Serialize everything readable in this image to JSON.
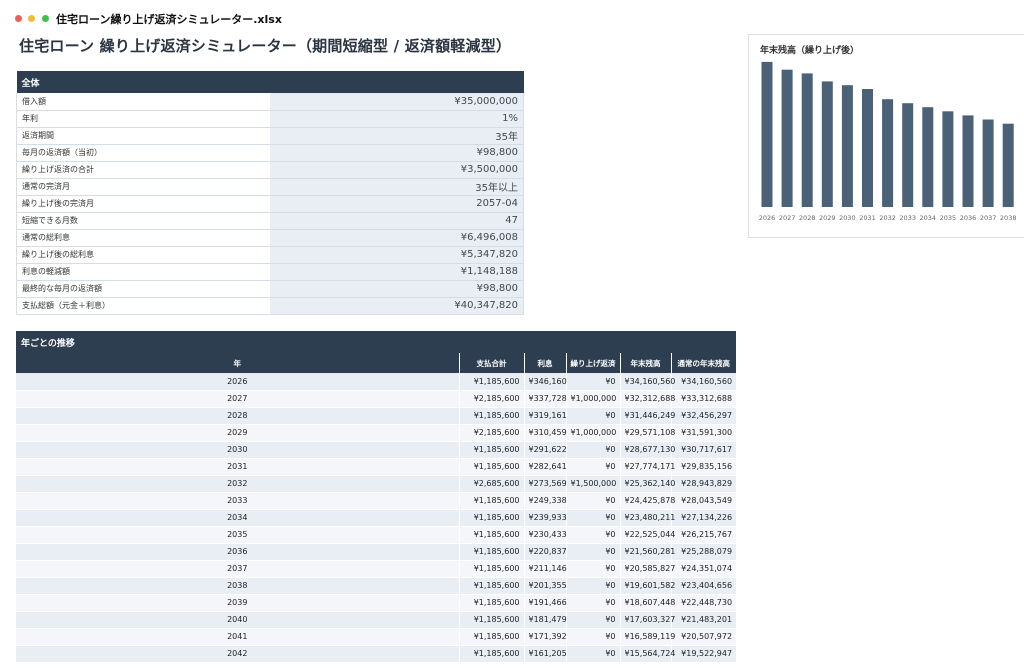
{
  "window": {
    "title": "住宅ローン繰り上げ返済シミュレーター.xlsx"
  },
  "page_title": "住宅ローン 繰り上げ返済シミュレーター（期間短縮型 / 返済額軽減型）",
  "summary": {
    "header": "全体",
    "rows": [
      {
        "label": "借入額",
        "value": "¥35,000,000"
      },
      {
        "label": "年利",
        "value": "1%"
      },
      {
        "label": "返済期間",
        "value": "35年"
      },
      {
        "label": "毎月の返済額（当初）",
        "value": "¥98,800"
      },
      {
        "label": "繰り上げ返済の合計",
        "value": "¥3,500,000"
      },
      {
        "label": "通常の完済月",
        "value": "35年以上"
      },
      {
        "label": "繰り上げ後の完済月",
        "value": "2057-04"
      },
      {
        "label": "短縮できる月数",
        "value": "47"
      },
      {
        "label": "通常の総利息",
        "value": "¥6,496,008"
      },
      {
        "label": "繰り上げ後の総利息",
        "value": "¥5,347,820"
      },
      {
        "label": "利息の軽減額",
        "value": "¥1,148,188"
      },
      {
        "label": "最終的な毎月の返済額",
        "value": "¥98,800"
      },
      {
        "label": "支払総額（元金＋利息）",
        "value": "¥40,347,820"
      }
    ]
  },
  "yearly": {
    "header": "年ごとの推移",
    "columns": [
      "年",
      "支払合計",
      "利息",
      "繰り上げ返済",
      "年末残高",
      "通常の年末残高"
    ],
    "rows": [
      [
        "2026",
        "¥1,185,600",
        "¥346,160",
        "¥0",
        "¥34,160,560",
        "¥34,160,560"
      ],
      [
        "2027",
        "¥2,185,600",
        "¥337,728",
        "¥1,000,000",
        "¥32,312,688",
        "¥33,312,688"
      ],
      [
        "2028",
        "¥1,185,600",
        "¥319,161",
        "¥0",
        "¥31,446,249",
        "¥32,456,297"
      ],
      [
        "2029",
        "¥2,185,600",
        "¥310,459",
        "¥1,000,000",
        "¥29,571,108",
        "¥31,591,300"
      ],
      [
        "2030",
        "¥1,185,600",
        "¥291,622",
        "¥0",
        "¥28,677,130",
        "¥30,717,617"
      ],
      [
        "2031",
        "¥1,185,600",
        "¥282,641",
        "¥0",
        "¥27,774,171",
        "¥29,835,156"
      ],
      [
        "2032",
        "¥2,685,600",
        "¥273,569",
        "¥1,500,000",
        "¥25,362,140",
        "¥28,943,829"
      ],
      [
        "2033",
        "¥1,185,600",
        "¥249,338",
        "¥0",
        "¥24,425,878",
        "¥28,043,549"
      ],
      [
        "2034",
        "¥1,185,600",
        "¥239,933",
        "¥0",
        "¥23,480,211",
        "¥27,134,226"
      ],
      [
        "2035",
        "¥1,185,600",
        "¥230,433",
        "¥0",
        "¥22,525,044",
        "¥26,215,767"
      ],
      [
        "2036",
        "¥1,185,600",
        "¥220,837",
        "¥0",
        "¥21,560,281",
        "¥25,288,079"
      ],
      [
        "2037",
        "¥1,185,600",
        "¥211,146",
        "¥0",
        "¥20,585,827",
        "¥24,351,074"
      ],
      [
        "2038",
        "¥1,185,600",
        "¥201,355",
        "¥0",
        "¥19,601,582",
        "¥23,404,656"
      ],
      [
        "2039",
        "¥1,185,600",
        "¥191,466",
        "¥0",
        "¥18,607,448",
        "¥22,448,730"
      ],
      [
        "2040",
        "¥1,185,600",
        "¥181,479",
        "¥0",
        "¥17,603,327",
        "¥21,483,201"
      ],
      [
        "2041",
        "¥1,185,600",
        "¥171,392",
        "¥0",
        "¥16,589,119",
        "¥20,507,972"
      ],
      [
        "2042",
        "¥1,185,600",
        "¥161,205",
        "¥0",
        "¥15,564,724",
        "¥19,522,947"
      ]
    ]
  },
  "chart_data": {
    "type": "bar",
    "title": "年末残高（繰り上げ後）",
    "categories": [
      "2026",
      "2027",
      "2028",
      "2029",
      "2030",
      "2031",
      "2032",
      "2033",
      "2034",
      "2035",
      "2036",
      "2037",
      "2038"
    ],
    "values": [
      34160560,
      32312688,
      31446249,
      29571108,
      28677130,
      27774171,
      25362140,
      24425878,
      23480211,
      22525044,
      21560281,
      20585827,
      19601582
    ],
    "ylim": [
      0,
      36000000
    ],
    "grid": false,
    "bar_color": "#4a6178"
  }
}
